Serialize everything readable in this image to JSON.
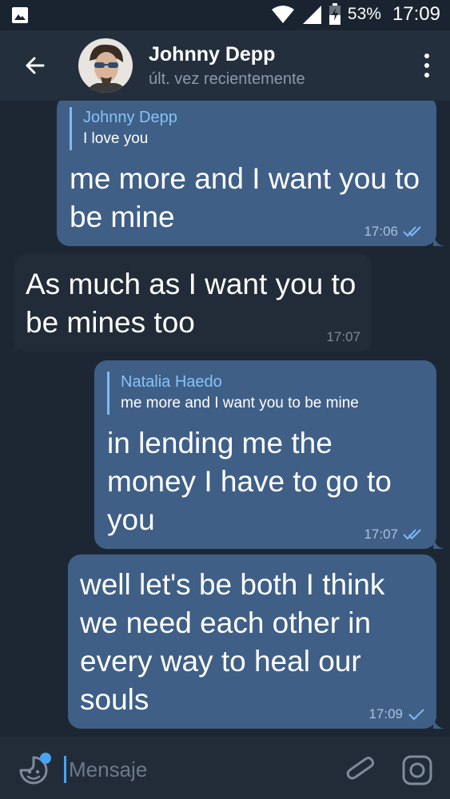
{
  "status_bar": {
    "battery": "53%",
    "time": "17:09",
    "icons": [
      "image-icon",
      "wifi-icon",
      "signal-icon",
      "battery-icon"
    ]
  },
  "header": {
    "contact_name": "Johnny Depp",
    "contact_status": "últ. vez recientemente",
    "icons": [
      "back-arrow-icon",
      "avatar",
      "more-vertical-icon"
    ]
  },
  "messages": [
    {
      "direction": "outgoing",
      "reply_to": {
        "name": "Johnny Depp",
        "text": "I love you"
      },
      "text": "me more and I want you to be mine",
      "time": "17:06",
      "status": "read"
    },
    {
      "direction": "incoming",
      "text": "As much as I want you to be mines too",
      "time": "17:07"
    },
    {
      "direction": "outgoing",
      "reply_to": {
        "name": "Natalia Haedo",
        "text": "me more and I want you to be mine"
      },
      "text": "in lending me the money I have to go to you",
      "time": "17:07",
      "status": "read"
    },
    {
      "direction": "outgoing",
      "text": "well let's be both I think we need each other in every way to heal our souls",
      "time": "17:09",
      "status": "sent"
    }
  ],
  "input_bar": {
    "placeholder": "Mensaje",
    "icons": [
      "sticker-emoji-icon",
      "paperclip-icon",
      "camera-icon"
    ]
  },
  "colors": {
    "background": "#1d2733",
    "header": "#232f3d",
    "outgoing_bubble": "#3f5f87",
    "incoming_bubble": "#222c38",
    "accent": "#4aa3f0"
  }
}
